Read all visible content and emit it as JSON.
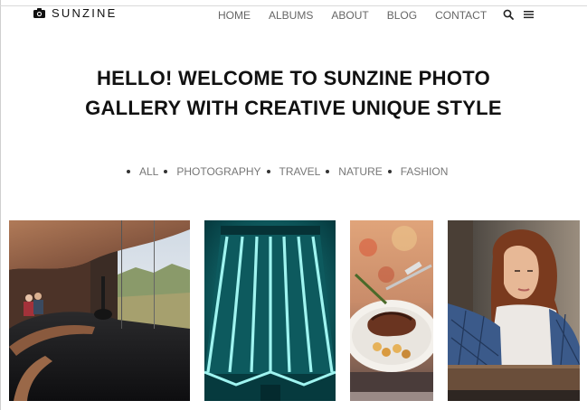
{
  "brand": {
    "name": "SUNZINE",
    "logo_icon": "camera-icon"
  },
  "nav": {
    "items": [
      {
        "label": "HOME"
      },
      {
        "label": "ALBUMS"
      },
      {
        "label": "ABOUT"
      },
      {
        "label": "BLOG"
      },
      {
        "label": "CONTACT"
      }
    ],
    "search_icon": "search-icon",
    "menu_icon": "hamburger-menu-icon"
  },
  "hero": {
    "line1": "HELLO! WELCOME TO SUNZINE PHOTO",
    "line2": "GALLERY WITH CREATIVE UNIQUE STYLE"
  },
  "filters": [
    {
      "label": "ALL"
    },
    {
      "label": "PHOTOGRAPHY"
    },
    {
      "label": "TRAVEL"
    },
    {
      "label": "NATURE"
    },
    {
      "label": "FASHION"
    }
  ],
  "gallery": [
    {
      "subject": "interior-lounge-mountain-view"
    },
    {
      "subject": "teal-neon-lampshade"
    },
    {
      "subject": "steak-dinner-plate"
    },
    {
      "subject": "woman-portrait"
    }
  ],
  "colors": {
    "text": "#111111",
    "nav": "#666666",
    "filter": "#777777",
    "teal": "#0a8f8f"
  }
}
